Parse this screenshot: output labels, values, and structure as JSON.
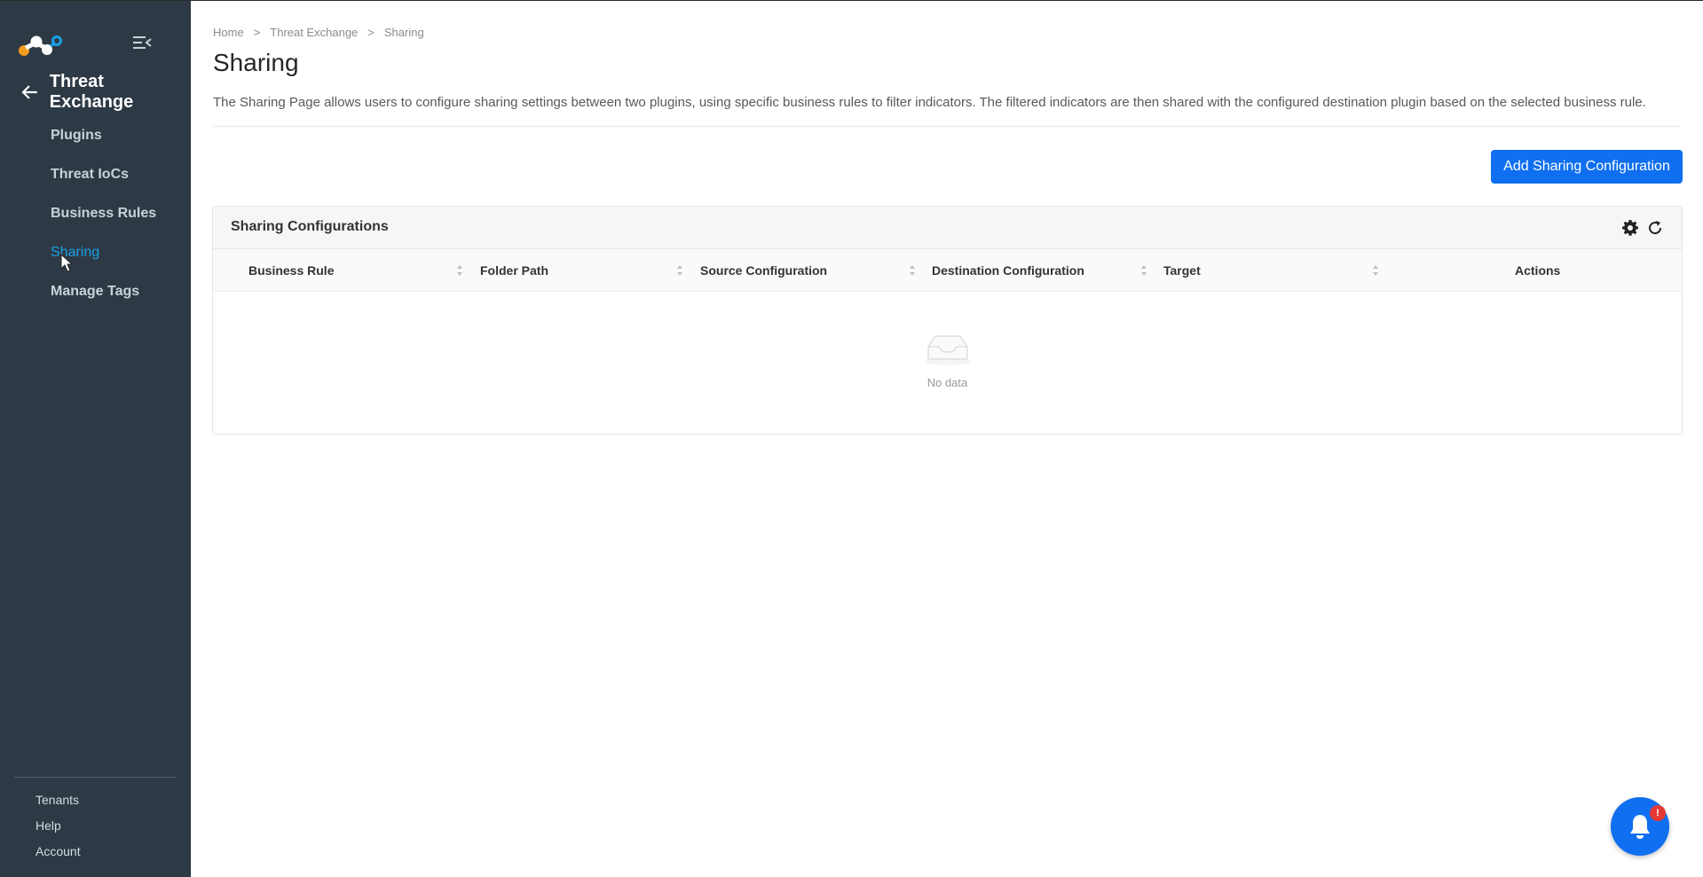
{
  "sidebar": {
    "back_title": "Threat Exchange",
    "items": [
      {
        "label": "Plugins",
        "active": false
      },
      {
        "label": "Threat IoCs",
        "active": false
      },
      {
        "label": "Business Rules",
        "active": false
      },
      {
        "label": "Sharing",
        "active": true
      },
      {
        "label": "Manage Tags",
        "active": false
      }
    ],
    "bottom": [
      {
        "label": "Tenants"
      },
      {
        "label": "Help"
      },
      {
        "label": "Account"
      }
    ]
  },
  "breadcrumb": [
    {
      "label": "Home"
    },
    {
      "label": "Threat Exchange"
    },
    {
      "label": "Sharing"
    }
  ],
  "breadcrumb_separator": ">",
  "page": {
    "title": "Sharing",
    "description": "The Sharing Page allows users to configure sharing settings between two plugins, using specific business rules to filter indicators. The filtered indicators are then shared with the configured destination plugin based on the selected business rule."
  },
  "add_button_label": "Add Sharing Configuration",
  "table": {
    "title": "Sharing Configurations",
    "columns": [
      {
        "label": "Business Rule",
        "sortable": true
      },
      {
        "label": "Folder Path",
        "sortable": true
      },
      {
        "label": "Source Configuration",
        "sortable": true
      },
      {
        "label": "Destination Configuration",
        "sortable": true
      },
      {
        "label": "Target",
        "sortable": true
      },
      {
        "label": "Actions",
        "sortable": false
      }
    ],
    "rows": [],
    "empty_text": "No data"
  },
  "notification": {
    "badge": "!"
  },
  "colors": {
    "sidebar_bg": "#2d3a45",
    "accent": "#0f6ff0",
    "active_nav": "#1aa0e6",
    "badge": "#e53935"
  },
  "icons": {
    "logo": "netskope-logo",
    "collapse": "menu-collapse-icon",
    "back": "arrow-left-icon",
    "settings": "gear-icon",
    "refresh": "refresh-icon",
    "sort": "sort-icon",
    "empty": "empty-inbox-icon",
    "bell": "bell-icon"
  }
}
